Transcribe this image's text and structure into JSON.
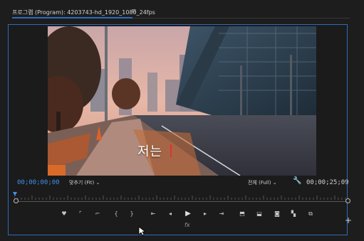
{
  "panel": {
    "title": "프로그램 (Program): 4203743-hd_1920_1080_24fps",
    "menu_icon": "hamburger-icon"
  },
  "video": {
    "subtitle": "저는"
  },
  "bottom_bar": {
    "timecode_current": "00;00;00;00",
    "fit_label": "맞추기 (Fit)",
    "resolution_label": "전체 (Full)",
    "timecode_duration": "00;00;25;09"
  },
  "controls": [
    {
      "name": "add-marker-button",
      "glyph": "♥"
    },
    {
      "name": "mark-in-button",
      "glyph": "⌜"
    },
    {
      "name": "mark-out-button",
      "glyph": "⌐"
    },
    {
      "name": "clear-in-button",
      "glyph": "{"
    },
    {
      "name": "clear-out-button",
      "glyph": "}"
    },
    {
      "name": "go-to-in-button",
      "glyph": "⇤"
    },
    {
      "name": "step-back-button",
      "glyph": "◂"
    },
    {
      "name": "play-button",
      "glyph": "▶"
    },
    {
      "name": "step-forward-button",
      "glyph": "▸"
    },
    {
      "name": "go-to-out-button",
      "glyph": "⇥"
    },
    {
      "name": "lift-button",
      "glyph": "⬒"
    },
    {
      "name": "extract-button",
      "glyph": "⬓"
    },
    {
      "name": "export-frame-button",
      "glyph": "◙"
    },
    {
      "name": "comparison-view-button",
      "glyph": "▚"
    },
    {
      "name": "proxy-toggle-button",
      "glyph": "⧉"
    }
  ],
  "fx_label": "fx",
  "colors": {
    "accent": "#2d6bbd",
    "timecode": "#3f8fe6",
    "background": "#1b1b1b"
  }
}
